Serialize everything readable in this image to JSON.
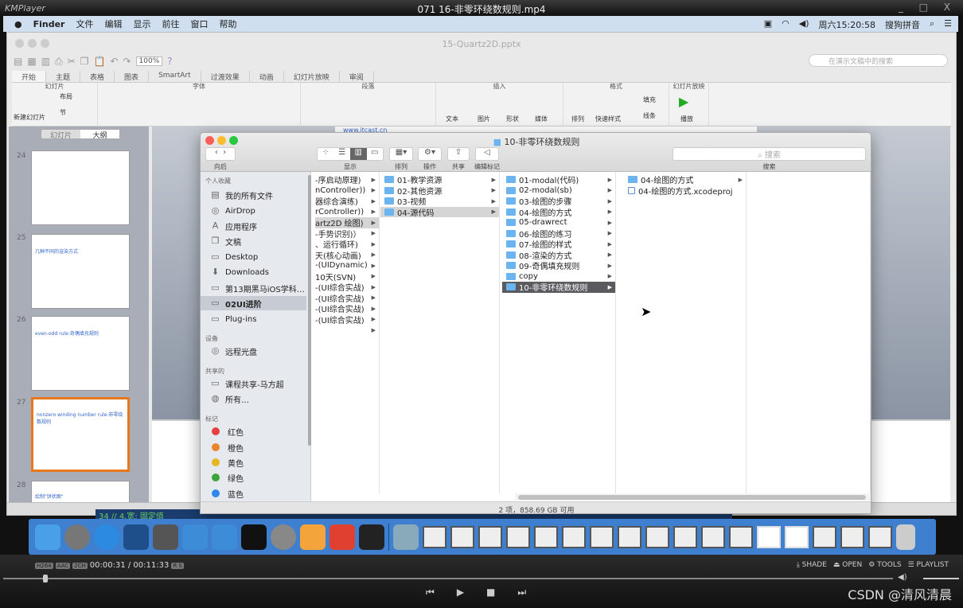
{
  "player": {
    "app_name": "KMPlayer",
    "title": "071 16-非零环绕数规则.mp4",
    "codecs": [
      "H264",
      "AAC",
      "2CH"
    ],
    "time": "00:00:31 / 00:11:33",
    "rs": "R S",
    "progress_fraction": 0.045,
    "buttons": {
      "shade": "SHADE",
      "open": "OPEN",
      "tools": "TOOLS",
      "playlist": "PLAYLIST"
    },
    "watermark": "CSDN @清风清晨"
  },
  "menubar": {
    "items": [
      "Finder",
      "文件",
      "编辑",
      "显示",
      "前往",
      "窗口",
      "帮助"
    ],
    "clock": "周六15:20:58",
    "ime": "搜狗拼音"
  },
  "ppt": {
    "title": "15-Quartz2D.pptx",
    "zoom": "100%",
    "search_placeholder": "在演示文稿中的搜索",
    "tabs": [
      "开始",
      "主题",
      "表格",
      "图表",
      "SmartArt",
      "过渡效果",
      "动画",
      "幻灯片放映",
      "审阅"
    ],
    "groups": [
      "幻灯片",
      "字体",
      "段落",
      "插入",
      "格式",
      "幻灯片放映"
    ],
    "ribbon_items": {
      "new_slide": "新建幻灯片",
      "layout": "布局",
      "section": "节",
      "text": "文本",
      "picture": "图片",
      "shape": "形状",
      "media": "媒体",
      "arrange": "排列",
      "quick_style": "快速样式",
      "fill": "填充",
      "line": "线条",
      "play": "播放"
    },
    "panel_tabs": [
      "幻灯片",
      "大纲"
    ],
    "slides": [
      {
        "num": "24",
        "title": ""
      },
      {
        "num": "25",
        "title": "几种不同的渲染方式"
      },
      {
        "num": "26",
        "title": "even-odd rule:奇偶填充规则"
      },
      {
        "num": "27",
        "title": "nonzero winding number rule:非零绕数规则"
      },
      {
        "num": "28",
        "title": "绘制\"饼状图\""
      }
    ],
    "slide_header": "www.itcast.cn",
    "notes_line": "34  // 4.宽: 固定值"
  },
  "finder": {
    "title": "10-非零环绕数规则",
    "toolbar": {
      "back": "向后",
      "view": "显示",
      "arrange": "排列",
      "action": "操作",
      "share": "共享",
      "tags": "编辑标记",
      "search_placeholder": "搜索",
      "search_label": "搜索"
    },
    "sidebar": {
      "favorites_header": "个人收藏",
      "favorites": [
        "我的所有文件",
        "AirDrop",
        "应用程序",
        "文稿",
        "Desktop",
        "Downloads",
        "第13期黑马iOS学科…",
        "02UI进阶",
        "Plug-ins"
      ],
      "devices_header": "设备",
      "devices": [
        "远程光盘"
      ],
      "shared_header": "共享的",
      "shared": [
        "课程共享-马方超",
        "所有…"
      ],
      "tags_header": "标记",
      "tags": [
        {
          "label": "红色",
          "color": "#e84040"
        },
        {
          "label": "橙色",
          "color": "#e8842a"
        },
        {
          "label": "黄色",
          "color": "#e8b624"
        },
        {
          "label": "绿色",
          "color": "#3aa53a"
        },
        {
          "label": "蓝色",
          "color": "#2d8ae8"
        }
      ]
    },
    "columns": [
      [
        "-序启动原理)",
        "nController))",
        "器综合演练)",
        "rController))",
        "artz2D 绘图)",
        "-手势识别)）",
        "、运行循环)",
        "天(核心动画)",
        "-(UIDynamic)",
        "10天(SVN)",
        "-(UI综合实战)",
        "-(UI综合实战)",
        "-(UI综合实战)",
        "-(UI综合实战)",
        ""
      ],
      [
        "01-教学资源",
        "02-其他资源",
        "03-视频",
        "04-源代码"
      ],
      [
        "01-modal(代码)",
        "02-modal(sb)",
        "03-绘图的步骤",
        "04-绘图的方式",
        "05-drawrect",
        "06-绘图的练习",
        "07-绘图的样式",
        "08-渲染的方式",
        "09-奇偶填充规则",
        "copy",
        "10-非零环绕数规则"
      ],
      [
        "04-绘图的方式",
        "04-绘图的方式.xcodeproj"
      ]
    ],
    "status": "2 项，858.69 GB 可用"
  }
}
